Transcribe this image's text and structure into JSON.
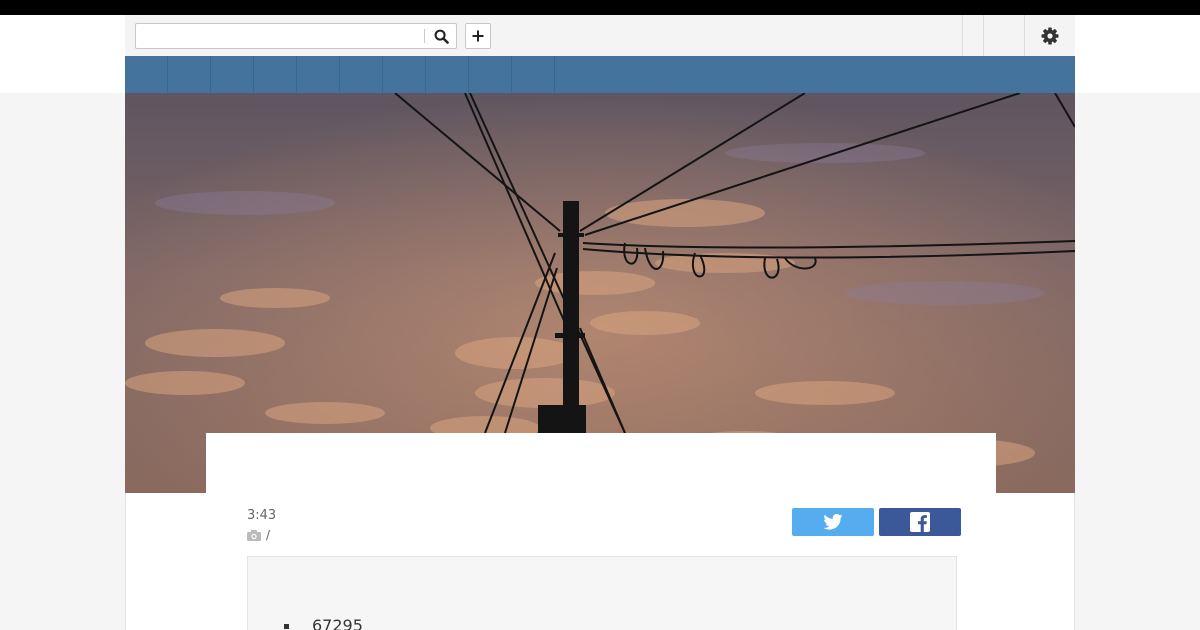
{
  "search": {
    "value": "",
    "placeholder": ""
  },
  "icons": {
    "search": "search-icon",
    "add": "plus-icon",
    "settings": "gear-icon",
    "camera": "camera-icon",
    "twitter": "twitter-icon",
    "facebook": "facebook-icon"
  },
  "colors": {
    "nav": "#44739d",
    "twitter": "#55acee",
    "facebook": "#3b5998"
  },
  "article": {
    "time": "3:43",
    "photo_credit": "/",
    "list_items": [
      "67295"
    ]
  }
}
